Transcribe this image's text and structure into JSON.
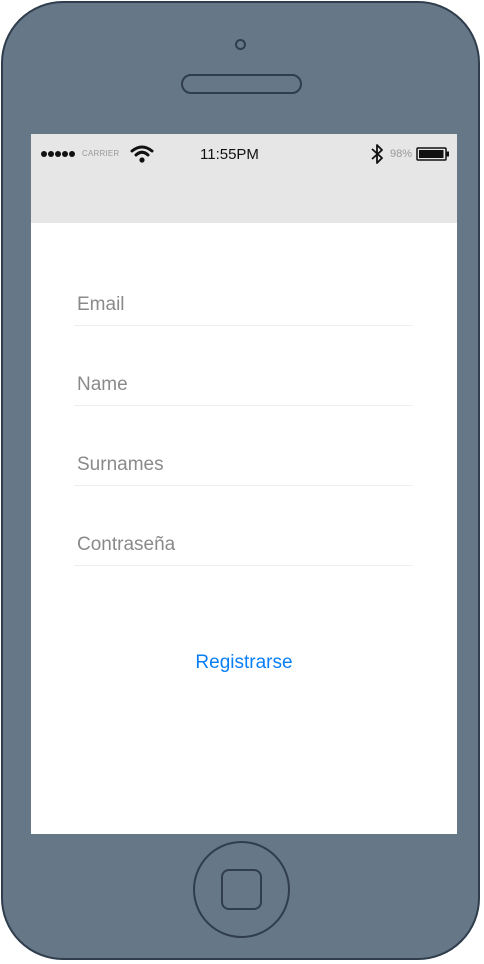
{
  "status_bar": {
    "carrier": "CARRIER",
    "time": "11:55PM",
    "battery_percent": "98%",
    "battery_level": 0.98,
    "signal_bars": 5,
    "icons": [
      "signal-dots-icon",
      "wifi-icon",
      "bluetooth-icon",
      "battery-icon"
    ]
  },
  "form": {
    "email_placeholder": "Email",
    "name_placeholder": "Name",
    "surnames_placeholder": "Surnames",
    "password_placeholder": "Contraseña",
    "email_value": "",
    "name_value": "",
    "surnames_value": "",
    "password_value": "",
    "register_label": "Registrarse"
  },
  "colors": {
    "device_body": "#667788",
    "navbar_background": "#e6e6e6",
    "accent": "#0a7ff5"
  }
}
